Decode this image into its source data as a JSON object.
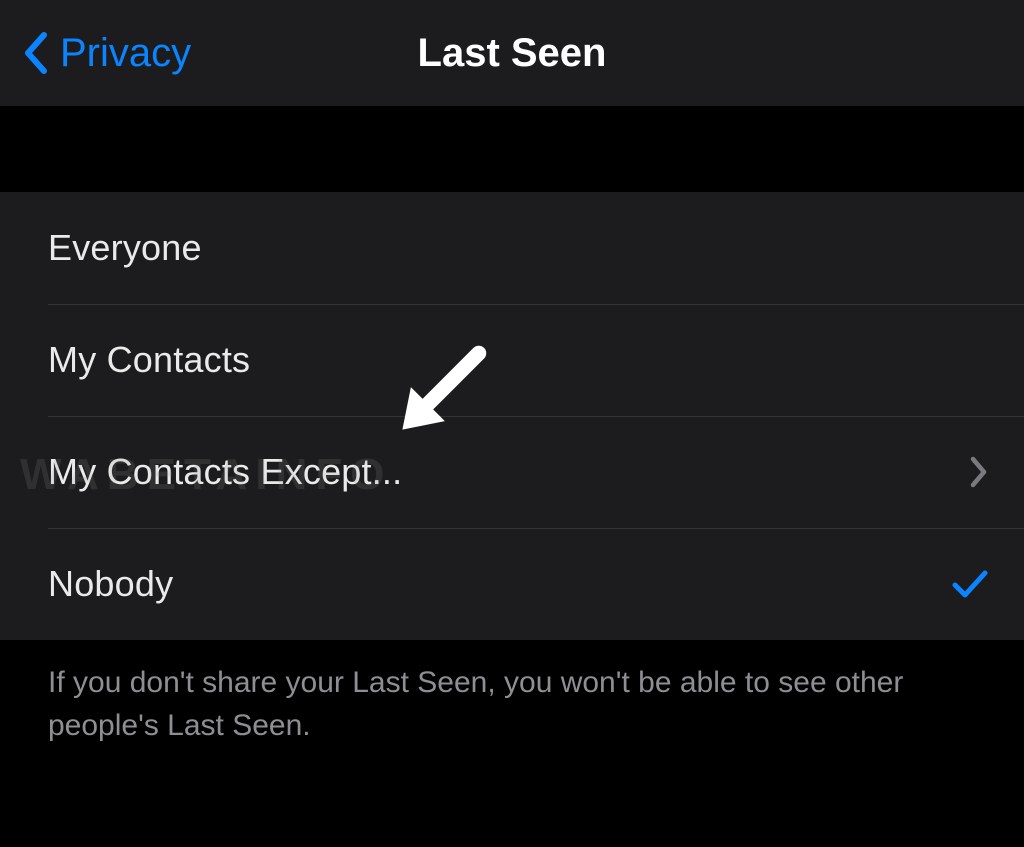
{
  "nav": {
    "back_label": "Privacy",
    "title": "Last Seen"
  },
  "options": [
    {
      "label": "Everyone",
      "selected": false,
      "disclosure": false
    },
    {
      "label": "My Contacts",
      "selected": false,
      "disclosure": false
    },
    {
      "label": "My Contacts Except...",
      "selected": false,
      "disclosure": true
    },
    {
      "label": "Nobody",
      "selected": true,
      "disclosure": false
    }
  ],
  "footer_text": "If you don't share your Last Seen, you won't be able to see other people's Last Seen.",
  "watermark": "WABETAINFO",
  "colors": {
    "accent": "#0a84ff",
    "bg_panel": "#1c1c1e",
    "bg_page": "#000000",
    "text_secondary": "#8e8e93"
  }
}
